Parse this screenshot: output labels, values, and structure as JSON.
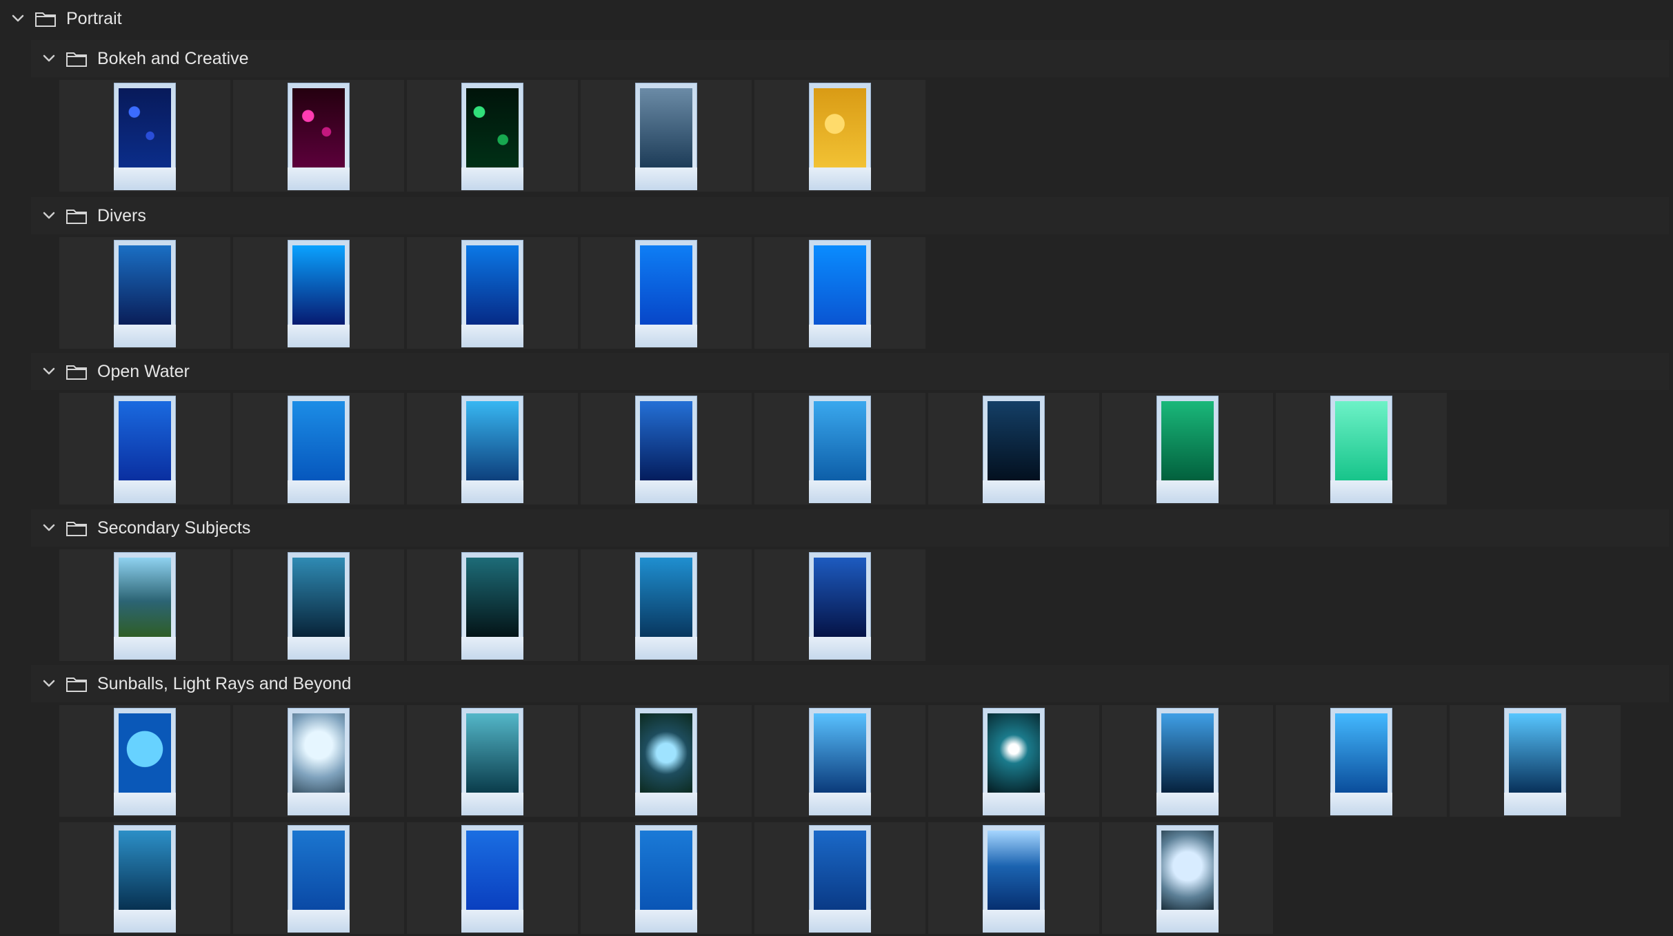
{
  "root": {
    "title": "Portrait",
    "expanded": true
  },
  "groups": [
    {
      "title": "Bokeh and Creative",
      "rows": [
        [
          {
            "gradient": "radial-gradient(circle at 30% 30%, #3b6cff 0 8%, transparent 9%), radial-gradient(circle at 60% 60%, #2a4ed8 0 7%, transparent 8%), linear-gradient(180deg,#081a5a,#0b2d8a)"
          },
          {
            "gradient": "radial-gradient(circle at 30% 35%, #ff3cb2 0 9%, transparent 10%), radial-gradient(circle at 65% 55%, #c2187e 0 8%, transparent 9%), linear-gradient(180deg,#24000f,#5c003b)"
          },
          {
            "gradient": "radial-gradient(circle at 25% 30%, #31e07a 0 8%, transparent 9%), radial-gradient(circle at 70% 65%, #17a84f 0 8%, transparent 9%), linear-gradient(180deg,#00140a,#003016)"
          },
          {
            "gradient": "linear-gradient(180deg,#6b8ba6,#1d3c58)"
          },
          {
            "gradient": "radial-gradient(circle at 40% 45%, #ffdb6b 0 18%, transparent 19%), linear-gradient(180deg,#d99b15,#f2c234)"
          }
        ]
      ]
    },
    {
      "title": "Divers",
      "rows": [
        [
          {
            "gradient": "linear-gradient(180deg,#1a6fc4,#0a1e58)"
          },
          {
            "gradient": "linear-gradient(180deg,#0aa2ff,#071a70)"
          },
          {
            "gradient": "linear-gradient(180deg,#0b78e6,#062a86)"
          },
          {
            "gradient": "linear-gradient(180deg,#0e7ef5,#0746c8)"
          },
          {
            "gradient": "linear-gradient(180deg,#0a8cff,#0a55d2)"
          }
        ]
      ]
    },
    {
      "title": "Open Water",
      "rows": [
        [
          {
            "gradient": "linear-gradient(180deg,#1a6ae0,#0a2fa0)"
          },
          {
            "gradient": "linear-gradient(180deg,#1c8de6,#0657bd)"
          },
          {
            "gradient": "linear-gradient(180deg,#38b7f2,#0d3f7c)"
          },
          {
            "gradient": "linear-gradient(180deg,#2470d6,#041d5d)"
          },
          {
            "gradient": "linear-gradient(180deg,#3aa8ee,#0d5ea8)"
          },
          {
            "gradient": "linear-gradient(180deg,#143f66,#03101f)"
          },
          {
            "gradient": "linear-gradient(180deg,#1ab87a,#02603d)"
          },
          {
            "gradient": "linear-gradient(180deg,#6df2c7,#17c48a)"
          }
        ]
      ]
    },
    {
      "title": "Secondary Subjects",
      "rows": [
        [
          {
            "gradient": "linear-gradient(180deg,#8fd2f0,#2c6474 55%,#2f5e26)"
          },
          {
            "gradient": "linear-gradient(180deg,#2f8bb4,#082338)"
          },
          {
            "gradient": "linear-gradient(180deg,#1d6c78,#041417)"
          },
          {
            "gradient": "linear-gradient(180deg,#1f8fd0,#08375f)"
          },
          {
            "gradient": "linear-gradient(180deg,#1d5bc0,#051346)"
          }
        ]
      ]
    },
    {
      "title": "Sunballs, Light Rays and Beyond",
      "rows": [
        [
          {
            "gradient": "radial-gradient(circle at 50% 45%, #67d2ff 0 35%, #0a58b8 36% 100%)"
          },
          {
            "gradient": "radial-gradient(circle at 50% 40%, #e6f6ff 0 25%, #7fa2bd 60%, #3a5466 100%)"
          },
          {
            "gradient": "linear-gradient(180deg,#54b7c9,#0a3c4b)"
          },
          {
            "gradient": "radial-gradient(circle at 50% 50%, #9fe3ff 0 20%, #1e4d5e 45%, #0c2a1f 100%)"
          },
          {
            "gradient": "linear-gradient(180deg,#59c1ff,#0a3a7a)"
          },
          {
            "gradient": "radial-gradient(circle at 50% 45%, #ffffff 0 10%, #1b7b8c 28%, #041b21 100%)"
          },
          {
            "gradient": "linear-gradient(180deg,#3f9fe6,#06223e)"
          },
          {
            "gradient": "linear-gradient(180deg,#44b9ff,#0a4d9b)"
          },
          {
            "gradient": "linear-gradient(180deg,#58c6ff,#08315a)"
          }
        ],
        [
          {
            "gradient": "linear-gradient(180deg,#2c8fc7,#073151)"
          },
          {
            "gradient": "linear-gradient(180deg,#1b76d0,#0a49a5)"
          },
          {
            "gradient": "linear-gradient(180deg,#1a6ee2,#0a3fbf)"
          },
          {
            "gradient": "linear-gradient(180deg,#1a7ad7,#0a55b5)"
          },
          {
            "gradient": "linear-gradient(180deg,#1a69c8,#0a3a86)"
          },
          {
            "gradient": "linear-gradient(180deg,#a6d6ff,#1b63b0 45%,#062f70)"
          },
          {
            "gradient": "radial-gradient(circle at 50% 45%, #d8ecff 0 28%, #5c7f96 62%, #1a2e3b 100%)"
          }
        ]
      ]
    }
  ]
}
